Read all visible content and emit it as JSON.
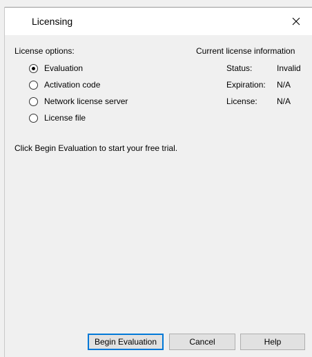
{
  "window": {
    "title": "Licensing"
  },
  "options": {
    "heading": "License options:",
    "items": [
      {
        "label": "Evaluation",
        "checked": true
      },
      {
        "label": "Activation code",
        "checked": false
      },
      {
        "label": "Network license server",
        "checked": false
      },
      {
        "label": "License file",
        "checked": false
      }
    ]
  },
  "info": {
    "heading": "Current license information",
    "rows": [
      {
        "key": "Status:",
        "value": "Invalid"
      },
      {
        "key": "Expiration:",
        "value": "N/A"
      },
      {
        "key": "License:",
        "value": "N/A"
      }
    ]
  },
  "message": "Click Begin Evaluation to start your free trial.",
  "buttons": {
    "begin": "Begin Evaluation",
    "cancel": "Cancel",
    "help": "Help"
  }
}
